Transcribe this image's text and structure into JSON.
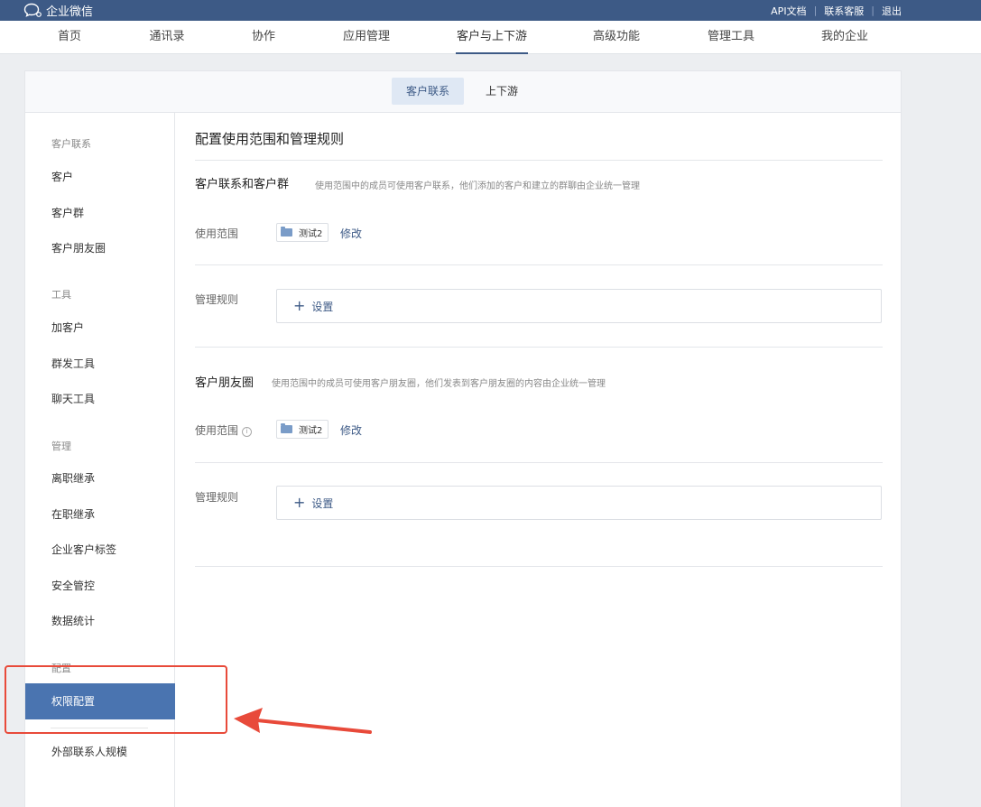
{
  "topbar": {
    "logo_text": "企业微信",
    "links": [
      "API文档",
      "联系客服",
      "退出"
    ]
  },
  "nav": {
    "items": [
      "首页",
      "通讯录",
      "协作",
      "应用管理",
      "客户与上下游",
      "高级功能",
      "管理工具",
      "我的企业"
    ],
    "active": "客户与上下游"
  },
  "subtabs": [
    "客户联系",
    "上下游"
  ],
  "sidebar": {
    "groups": [
      "客户联系",
      "工具",
      "管理",
      "配置"
    ],
    "items": [
      "客户",
      "客户群",
      "客户朋友圈",
      "加客户",
      "群发工具",
      "聊天工具",
      "离职继承",
      "在职继承",
      "企业客户标签",
      "安全管控",
      "数据统计",
      "权限配置",
      "外部联系人规模"
    ],
    "active": "权限配置"
  },
  "content": {
    "title": "配置使用范围和管理规则",
    "sections": [
      {
        "title": "客户联系和客户群",
        "desc": "使用范围中的成员可使用客户联系，他们添加的客户和建立的群聊由企业统一管理",
        "scope_label": "使用范围",
        "scope_value": "测试2",
        "modify_label": "修改",
        "rule_label": "管理规则",
        "rule_action": "设置"
      },
      {
        "title": "客户朋友圈",
        "desc": "使用范围中的成员可使用客户朋友圈，他们发表到客户朋友圈的内容由企业统一管理",
        "scope_label": "使用范围",
        "scope_value": "测试2",
        "modify_label": "修改",
        "rule_label": "管理规则",
        "rule_action": "设置"
      }
    ]
  },
  "colors": {
    "topbar": "#3d5a86",
    "accent": "#3d5a86",
    "active_sidebar": "#4a74b0",
    "annotation": "#e84a3a"
  }
}
